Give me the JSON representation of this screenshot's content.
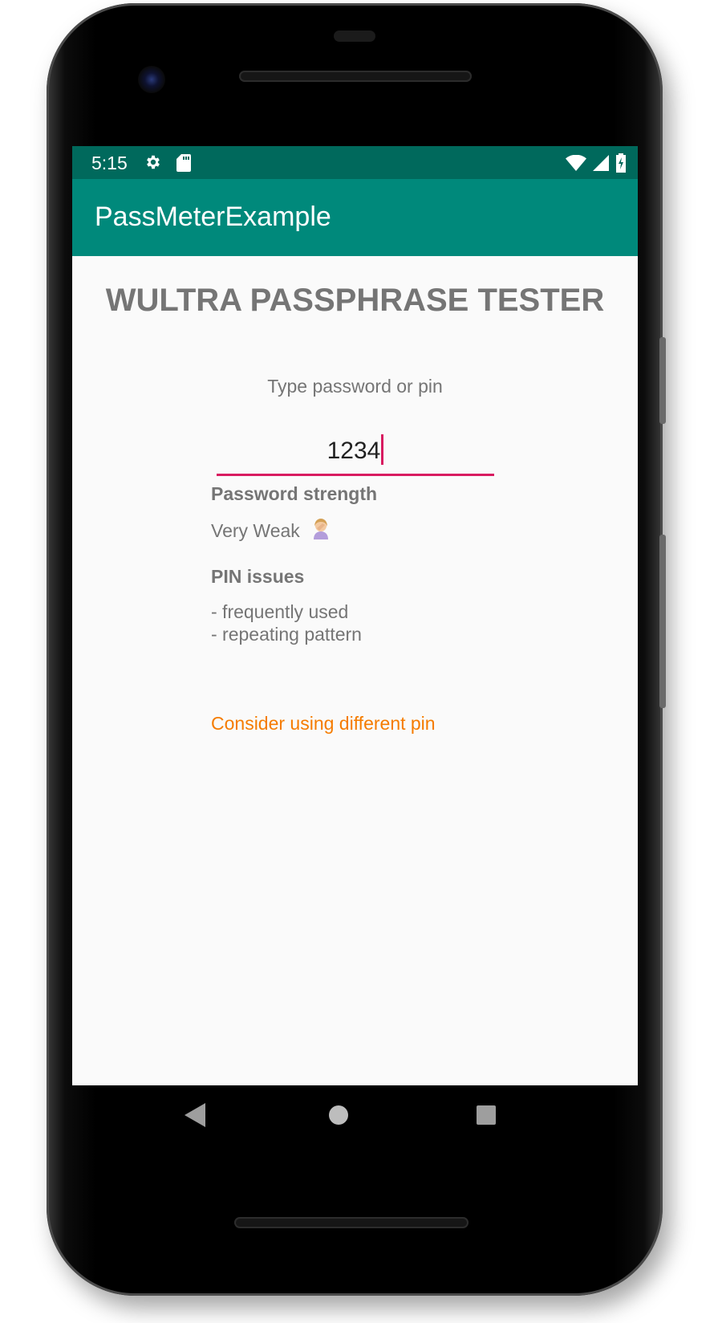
{
  "status_bar": {
    "time": "5:15",
    "left_icons": [
      "gear-icon",
      "sd-card-icon"
    ],
    "right_icons": [
      "wifi-icon",
      "cellular-signal-icon",
      "battery-charging-icon"
    ]
  },
  "app_bar": {
    "title": "PassMeterExample"
  },
  "main": {
    "heading": "WULTRA PASSPHRASE TESTER",
    "prompt": "Type password or pin",
    "input_value": "1234",
    "strength_label": "Password strength",
    "strength_value": "Very Weak",
    "strength_icon": "person-facepalming-icon",
    "issues_label": "PIN issues",
    "issues": [
      "- frequently used",
      "- repeating pattern"
    ],
    "warning": "Consider using different pin"
  },
  "nav_bar": {
    "buttons": [
      "back-icon",
      "home-icon",
      "recents-icon"
    ]
  },
  "colors": {
    "status_bar": "#00695c",
    "app_bar": "#00897b",
    "accent": "#d81b60",
    "warning": "#f57c00",
    "text_secondary": "#757575"
  }
}
